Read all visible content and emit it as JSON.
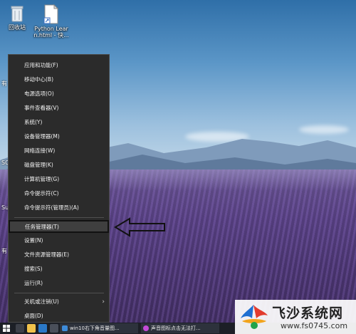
{
  "desktop": {
    "icons": [
      {
        "label": "回收站"
      },
      {
        "label_line1": "Python Lear",
        "label_line2": "n.html - 快..."
      }
    ],
    "partial_labels": [
      "有",
      "SQ",
      "Sul",
      "有"
    ]
  },
  "context_menu": {
    "items": [
      {
        "label": "应用和功能(F)"
      },
      {
        "label": "移动中心(B)"
      },
      {
        "label": "电源选项(O)"
      },
      {
        "label": "事件查看器(V)"
      },
      {
        "label": "系统(Y)"
      },
      {
        "label": "设备管理器(M)"
      },
      {
        "label": "网络连接(W)"
      },
      {
        "label": "磁盘管理(K)"
      },
      {
        "label": "计算机管理(G)"
      },
      {
        "label": "命令提示符(C)"
      },
      {
        "label": "命令提示符(管理员)(A)"
      },
      {
        "label": "任务管理器(T)"
      },
      {
        "label": "设置(N)"
      },
      {
        "label": "文件资源管理器(E)"
      },
      {
        "label": "搜索(S)"
      },
      {
        "label": "运行(R)"
      },
      {
        "label": "关机或注销(U)",
        "submenu_glyph": "›"
      },
      {
        "label": "桌面(D)"
      }
    ],
    "selected_item": "任务管理器(T)"
  },
  "taskbar": {
    "buttons": [
      {
        "label": "win10右下角音量图..."
      },
      {
        "label": "声音图标点击无法打..."
      }
    ]
  },
  "watermark": {
    "title": "飞沙系统网",
    "url": "www.fs0745.com"
  },
  "colors": {
    "menu_bg": "#2b2b2b",
    "menu_text": "#f2f2f2",
    "selected_bg": "#3f3f3f",
    "taskbar_bg": "#1c1f26"
  }
}
